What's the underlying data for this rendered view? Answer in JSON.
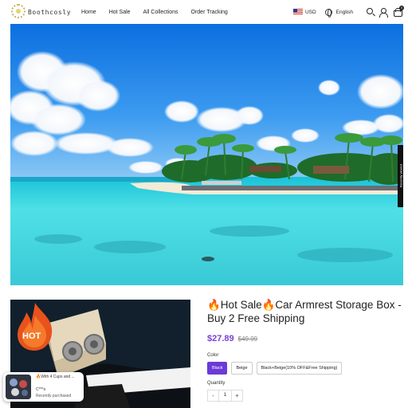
{
  "header": {
    "logo_text": "Boothcosly",
    "nav": [
      "Home",
      "Hot Sale",
      "All Collections",
      "Order Tracking"
    ],
    "currency": "USD",
    "language": "English",
    "cart_count": "0"
  },
  "side_tab": {
    "label": "Recently viewed"
  },
  "product": {
    "title": "🔥Hot Sale🔥Car Armrest Storage Box - Buy 2 Free Shipping",
    "price": "$27.89",
    "old_price": "$49.99",
    "color_label": "Color",
    "colors": [
      "Black",
      "Beige",
      "Black+Beige(10% OFF&Free Shipping)"
    ],
    "selected_color": "Black",
    "quantity_label": "Quantity",
    "quantity": "1",
    "minus": "-",
    "plus": "+",
    "hot_badge": "HOT"
  },
  "popup": {
    "product": "🔥With 4 Cups and ...",
    "customer": "C***o",
    "status": "Recently purchased"
  },
  "colors": {
    "accent": "#6c3ad6",
    "price": "#7b3fd6",
    "sky": "#1a7de0",
    "sea": "#35d3e3"
  }
}
